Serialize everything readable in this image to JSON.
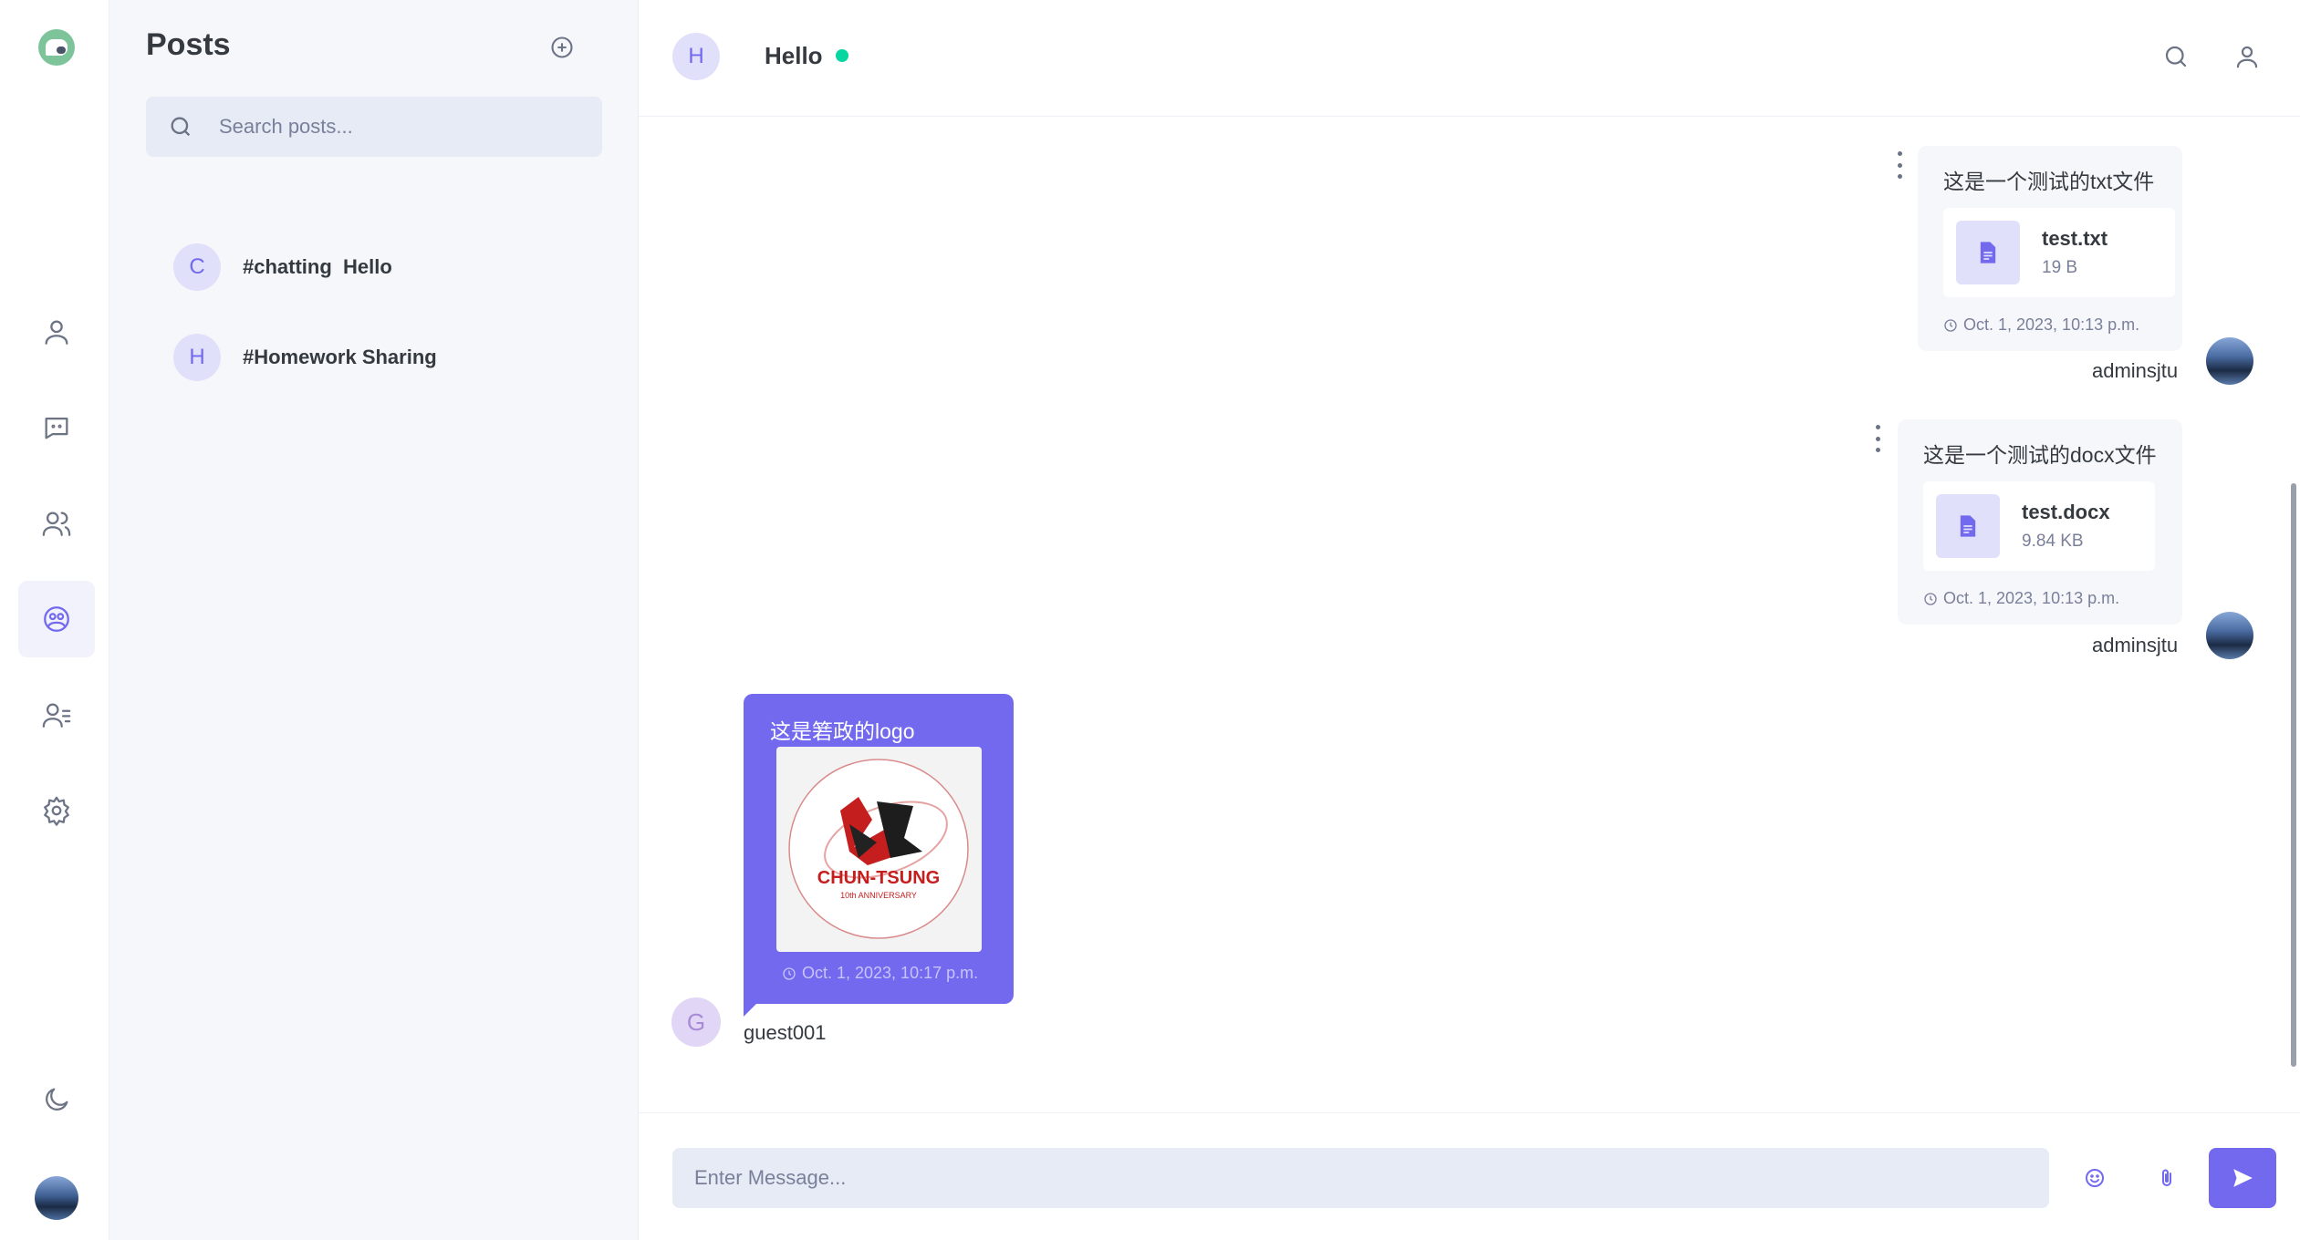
{
  "rail": {
    "items": [
      "profile-icon",
      "chat-icon",
      "groups-icon",
      "posts-icon",
      "contacts-icon",
      "settings-icon"
    ],
    "active": "posts-icon",
    "bottom": [
      "moon-icon",
      "user-avatar"
    ]
  },
  "sidebar": {
    "title": "Posts",
    "search_placeholder": "Search posts...",
    "posts": [
      {
        "initial": "C",
        "name": "#chatting  Hello"
      },
      {
        "initial": "H",
        "name": "#Homework Sharing"
      }
    ]
  },
  "chat": {
    "header": {
      "initial": "H",
      "name": "Hello",
      "status_color": "#06d6a0"
    },
    "messages": [
      {
        "text": "这是一个测试的txt文件",
        "file_name": "test.txt",
        "file_size": "19 B",
        "time": "Oct. 1, 2023, 10:13 p.m.",
        "sender": "adminsjtu"
      },
      {
        "text": "这是一个测试的docx文件",
        "file_name": "test.docx",
        "file_size": "9.84 KB",
        "time": "Oct. 1, 2023, 10:13 p.m.",
        "sender": "adminsjtu"
      },
      {
        "text": "这是箬政的logo",
        "image_text": "CHUN-TSUNG",
        "image_subtext": "10th ANNIVERSARY",
        "time": "Oct. 1, 2023, 10:17 p.m.",
        "sender": "guest001",
        "initial": "G"
      }
    ],
    "composer": {
      "placeholder": "Enter Message..."
    }
  },
  "colors": {
    "accent": "#7269ef",
    "sidebar_bg": "#f5f7fb",
    "input_bg": "#e6ebf5"
  }
}
